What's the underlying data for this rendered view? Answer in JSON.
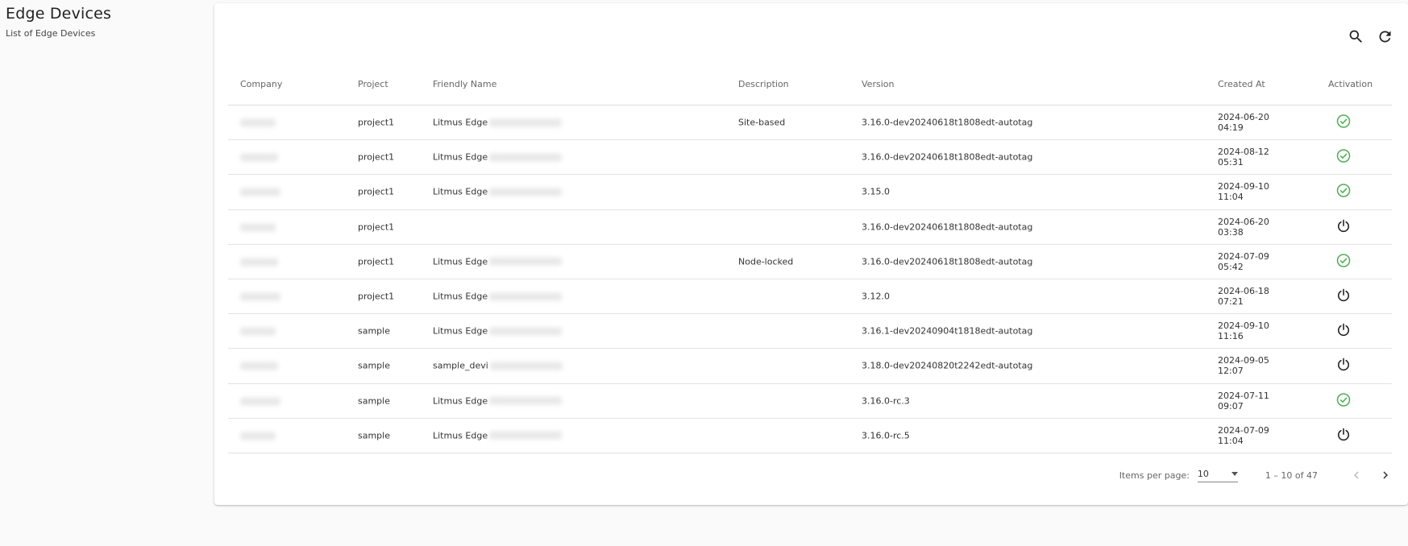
{
  "page": {
    "title": "Edge Devices",
    "subtitle": "List of Edge Devices"
  },
  "toolbar": {
    "search_icon": "search-icon",
    "refresh_icon": "refresh-icon"
  },
  "table": {
    "headers": {
      "company": "Company",
      "project": "Project",
      "friendly_name": "Friendly Name",
      "description": "Description",
      "version": "Version",
      "created_at": "Created At",
      "activation": "Activation"
    },
    "rows": [
      {
        "project": "project1",
        "name": "Litmus Edge",
        "description": "Site-based",
        "version": "3.16.0-dev20240618t1808edt-autotag",
        "date": "2024-06-20",
        "time": "04:19",
        "activation": "activated"
      },
      {
        "project": "project1",
        "name": "Litmus Edge",
        "description": "",
        "version": "3.16.0-dev20240618t1808edt-autotag",
        "date": "2024-08-12",
        "time": "05:31",
        "activation": "activated"
      },
      {
        "project": "project1",
        "name": "Litmus Edge",
        "description": "",
        "version": "3.15.0",
        "date": "2024-09-10",
        "time": "11:04",
        "activation": "activated"
      },
      {
        "project": "project1",
        "name": "",
        "description": "",
        "version": "3.16.0-dev20240618t1808edt-autotag",
        "date": "2024-06-20",
        "time": "03:38",
        "activation": "inactive"
      },
      {
        "project": "project1",
        "name": "Litmus Edge",
        "description": "Node-locked",
        "version": "3.16.0-dev20240618t1808edt-autotag",
        "date": "2024-07-09",
        "time": "05:42",
        "activation": "activated"
      },
      {
        "project": "project1",
        "name": "Litmus Edge",
        "description": "",
        "version": "3.12.0",
        "date": "2024-06-18",
        "time": "07:21",
        "activation": "inactive"
      },
      {
        "project": "sample",
        "name": "Litmus Edge",
        "description": "",
        "version": "3.16.1-dev20240904t1818edt-autotag",
        "date": "2024-09-10",
        "time": "11:16",
        "activation": "inactive"
      },
      {
        "project": "sample",
        "name": "sample_devi",
        "description": "",
        "version": "3.18.0-dev20240820t2242edt-autotag",
        "date": "2024-09-05",
        "time": "12:07",
        "activation": "inactive"
      },
      {
        "project": "sample",
        "name": "Litmus Edge",
        "description": "",
        "version": "3.16.0-rc.3",
        "date": "2024-07-11",
        "time": "09:07",
        "activation": "activated"
      },
      {
        "project": "sample",
        "name": "Litmus Edge",
        "description": "",
        "version": "3.16.0-rc.5",
        "date": "2024-07-09",
        "time": "11:04",
        "activation": "inactive"
      }
    ]
  },
  "paginator": {
    "items_per_page_label": "Items per page:",
    "page_size": "10",
    "range": "1 – 10 of 47"
  },
  "colors": {
    "activated": "#4caf50",
    "inactive": "#222222",
    "background": "#fafafa"
  }
}
